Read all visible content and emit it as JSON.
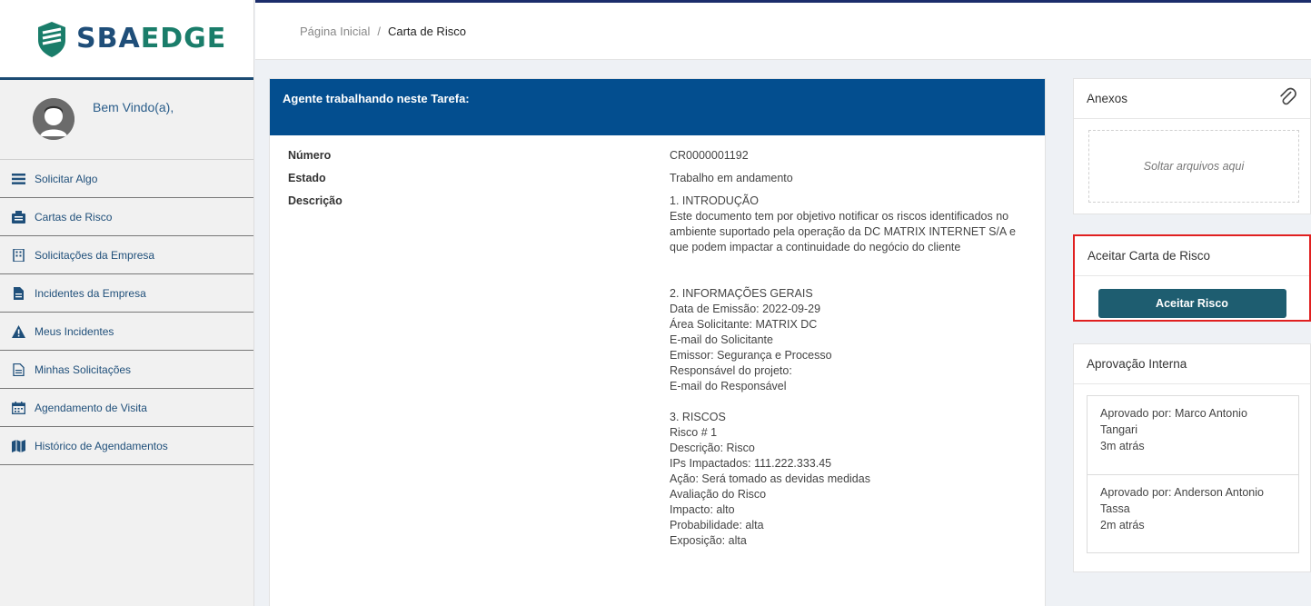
{
  "app": {
    "brand_a": "SBA",
    "brand_b": "EDGE",
    "welcome": "Bem Vindo(a),"
  },
  "sidebar": {
    "items": [
      {
        "label": "Solicitar Algo",
        "icon": "list-icon"
      },
      {
        "label": "Cartas de Risco",
        "icon": "document-folder-icon"
      },
      {
        "label": "Solicitações da Empresa",
        "icon": "building-icon"
      },
      {
        "label": "Incidentes da Empresa",
        "icon": "file-icon"
      },
      {
        "label": "Meus Incidentes",
        "icon": "warning-icon"
      },
      {
        "label": "Minhas Solicitações",
        "icon": "file-lines-icon"
      },
      {
        "label": "Agendamento de Visita",
        "icon": "calendar-icon"
      },
      {
        "label": "Histórico de Agendamentos",
        "icon": "map-icon"
      }
    ]
  },
  "breadcrumb": {
    "home": "Página Inicial",
    "separator": "/",
    "current": "Carta de Risco"
  },
  "task": {
    "header": "Agente trabalhando neste Tarefa:",
    "fields": {
      "numero_label": "Número",
      "numero_value": "CR0000001192",
      "estado_label": "Estado",
      "estado_value": "Trabalho em andamento",
      "descricao_label": "Descrição"
    },
    "description": {
      "l1": "1. INTRODUÇÃO",
      "l2": "Este documento tem por objetivo notificar os riscos identificados no",
      "l3": "ambiente suportado pela operação da DC MATRIX INTERNET S/A e",
      "l4": "que podem impactar a continuidade do negócio do cliente",
      "l5": "2. INFORMAÇÕES GERAIS",
      "l6": "Data de Emissão: 2022-09-29",
      "l7": "Área Solicitante: MATRIX DC",
      "l8": "E-mail do Solicitante",
      "l9": "Emissor: Segurança e Processo",
      "l10": "Responsável do projeto:",
      "l11": "E-mail do Responsável",
      "l12": "3. RISCOS",
      "l13": "Risco # 1",
      "l14": "Descrição: Risco",
      "l15": "IPs Impactados: 111.222.333.45",
      "l16": "Ação: Será tomado as devidas medidas",
      "l17": "Avaliação do Risco",
      "l18": "Impacto: alto",
      "l19": "Probabilidade: alta",
      "l20": "Exposição: alta"
    }
  },
  "attachments": {
    "title": "Anexos",
    "dropzone": "Soltar arquivos aqui"
  },
  "accept": {
    "title": "Aceitar Carta de Risco",
    "button": "Aceitar Risco"
  },
  "approval": {
    "title": "Aprovação Interna",
    "items": [
      {
        "text": "Aprovado por: Marco Antonio Tangari",
        "time": "3m atrás"
      },
      {
        "text": "Aprovado por: Anderson Antonio Tassa",
        "time": "2m atrás"
      }
    ]
  },
  "colors": {
    "header_blue": "#034e8f",
    "accept_button": "#1e5d70",
    "highlight_red": "#e02020",
    "brand_green": "#1a7d6a"
  }
}
